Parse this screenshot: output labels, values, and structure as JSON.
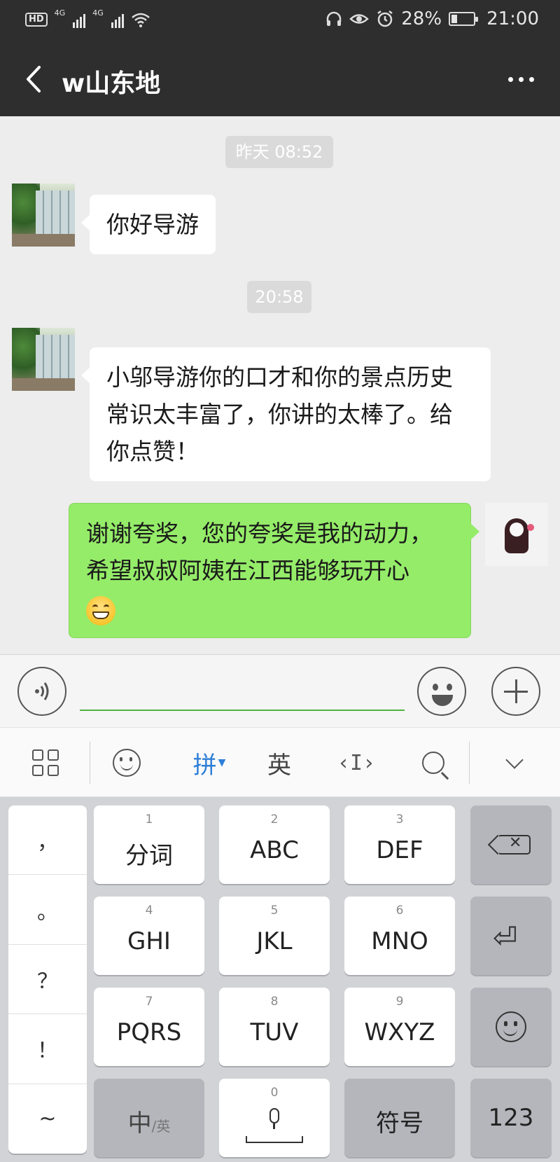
{
  "status_bar": {
    "hd": "HD",
    "network_1": "4G",
    "network_2": "4G",
    "battery": "28%",
    "battery_level": 0.28,
    "time": "21:00"
  },
  "nav": {
    "title": "w山东地"
  },
  "chat": {
    "timestamps": [
      "昨天 08:52",
      "20:58"
    ],
    "messages": [
      {
        "from": "other",
        "text": "你好导游"
      },
      {
        "from": "other",
        "text": "小邬导游你的口才和你的景点历史常识太丰富了，你讲的太棒了。给你点赞！"
      },
      {
        "from": "me",
        "text": "谢谢夸奖，您的夸奖是我的动力，希望叔叔阿姨在江西能够玩开心",
        "emoji": "grin"
      }
    ]
  },
  "input": {
    "value": "",
    "placeholder": ""
  },
  "ime_toolbar": {
    "pinyin": "拼",
    "english": "英"
  },
  "keyboard": {
    "punctuation": [
      "，",
      "。",
      "？",
      "！",
      "~"
    ],
    "keys": [
      {
        "num": "1",
        "label": "分词"
      },
      {
        "num": "2",
        "label": "ABC"
      },
      {
        "num": "3",
        "label": "DEF"
      },
      {
        "num": "4",
        "label": "GHI"
      },
      {
        "num": "5",
        "label": "JKL"
      },
      {
        "num": "6",
        "label": "MNO"
      },
      {
        "num": "7",
        "label": "PQRS"
      },
      {
        "num": "8",
        "label": "TUV"
      },
      {
        "num": "9",
        "label": "WXYZ"
      }
    ],
    "zh_label": "中",
    "en_label": "/英",
    "space_num": "0",
    "symbols": "符号",
    "numbers": "123"
  }
}
